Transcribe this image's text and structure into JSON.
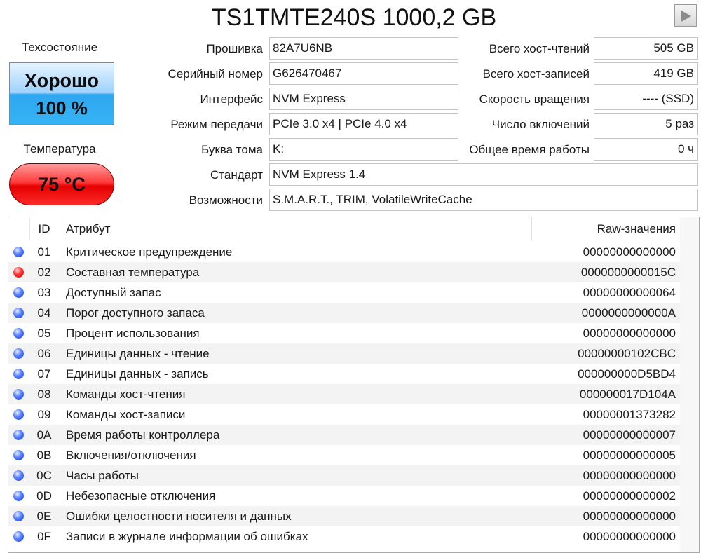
{
  "title": "TS1TMTE240S 1000,2 GB",
  "status": {
    "label": "Техсостояние",
    "value": "Хорошо",
    "percent": "100 %"
  },
  "temperature": {
    "label": "Температура",
    "value": "75 °C"
  },
  "info_left": [
    {
      "label": "Прошивка",
      "value": "82A7U6NB"
    },
    {
      "label": "Серийный номер",
      "value": "G626470467"
    },
    {
      "label": "Интерфейс",
      "value": "NVM Express"
    },
    {
      "label": "Режим передачи",
      "value": "PCIe 3.0 x4 | PCIe 4.0 x4"
    },
    {
      "label": "Буква тома",
      "value": "K:"
    },
    {
      "label": "Стандарт",
      "value": "NVM Express 1.4"
    },
    {
      "label": "Возможности",
      "value": "S.M.A.R.T., TRIM, VolatileWriteCache"
    }
  ],
  "info_right": [
    {
      "label": "Всего хост-чтений",
      "value": "505 GB"
    },
    {
      "label": "Всего хост-записей",
      "value": "419 GB"
    },
    {
      "label": "Скорость вращения",
      "value": "---- (SSD)"
    },
    {
      "label": "Число включений",
      "value": "5 раз"
    },
    {
      "label": "Общее время работы",
      "value": "0 ч"
    }
  ],
  "table": {
    "headers": {
      "id": "ID",
      "attr": "Атрибут",
      "raw": "Raw-значения"
    },
    "rows": [
      {
        "status": "blue",
        "id": "01",
        "attr": "Критическое предупреждение",
        "raw": "00000000000000"
      },
      {
        "status": "red",
        "id": "02",
        "attr": "Составная температура",
        "raw": "0000000000015C"
      },
      {
        "status": "blue",
        "id": "03",
        "attr": "Доступный запас",
        "raw": "00000000000064"
      },
      {
        "status": "blue",
        "id": "04",
        "attr": "Порог доступного запаса",
        "raw": "0000000000000A"
      },
      {
        "status": "blue",
        "id": "05",
        "attr": "Процент использования",
        "raw": "00000000000000"
      },
      {
        "status": "blue",
        "id": "06",
        "attr": "Единицы данных - чтение",
        "raw": "00000000102CBC"
      },
      {
        "status": "blue",
        "id": "07",
        "attr": "Единицы данных - запись",
        "raw": "000000000D5BD4"
      },
      {
        "status": "blue",
        "id": "08",
        "attr": "Команды хост-чтения",
        "raw": "000000017D104A"
      },
      {
        "status": "blue",
        "id": "09",
        "attr": "Команды хост-записи",
        "raw": "00000001373282"
      },
      {
        "status": "blue",
        "id": "0A",
        "attr": "Время работы контроллера",
        "raw": "00000000000007"
      },
      {
        "status": "blue",
        "id": "0B",
        "attr": "Включения/отключения",
        "raw": "00000000000005"
      },
      {
        "status": "blue",
        "id": "0C",
        "attr": "Часы работы",
        "raw": "00000000000000"
      },
      {
        "status": "blue",
        "id": "0D",
        "attr": "Небезопасные отключения",
        "raw": "00000000000002"
      },
      {
        "status": "blue",
        "id": "0E",
        "attr": "Ошибки целостности носителя и данных",
        "raw": "00000000000000"
      },
      {
        "status": "blue",
        "id": "0F",
        "attr": "Записи в журнале информации об ошибках",
        "raw": "00000000000000"
      }
    ]
  },
  "icons": {
    "next": "play-icon",
    "status_good": "blue",
    "status_warn": "red"
  }
}
